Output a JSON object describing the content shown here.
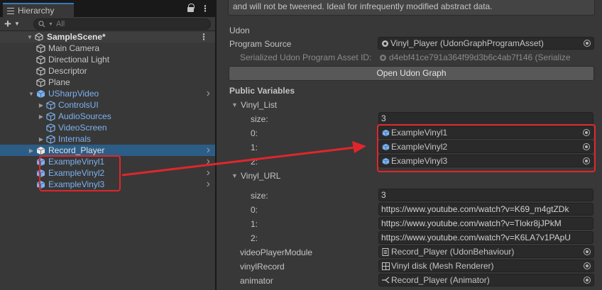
{
  "hierarchy": {
    "tab_label": "Hierarchy",
    "lock_icon": "lock-icon",
    "menu_icon": "kebab-menu-icon",
    "add_label": "+",
    "search_placeholder": "All",
    "scene": {
      "name": "SampleScene*"
    },
    "items": [
      {
        "label": "Main Camera",
        "style": "normal",
        "foldout": false,
        "arrow": false
      },
      {
        "label": "Directional Light",
        "style": "normal",
        "foldout": false,
        "arrow": false
      },
      {
        "label": "Descriptor",
        "style": "normal",
        "foldout": false,
        "arrow": false
      },
      {
        "label": "Plane",
        "style": "normal",
        "foldout": false,
        "arrow": false
      },
      {
        "label": "USharpVideo",
        "style": "prefab",
        "foldout": "open",
        "arrow": true
      },
      {
        "label": "ControlsUI",
        "style": "prefab",
        "foldout": "closed",
        "arrow": false
      },
      {
        "label": "AudioSources",
        "style": "prefab",
        "foldout": "closed",
        "arrow": false
      },
      {
        "label": "VideoScreen",
        "style": "prefab",
        "foldout": false,
        "arrow": false
      },
      {
        "label": "Internals",
        "style": "prefab",
        "foldout": "closed",
        "arrow": false
      },
      {
        "label": "Record_Player",
        "style": "selected",
        "foldout": "closed",
        "arrow": true
      },
      {
        "label": "ExampleVinyl1",
        "style": "prefab",
        "foldout": false,
        "arrow": true
      },
      {
        "label": "ExampleVinyl2",
        "style": "prefab",
        "foldout": false,
        "arrow": true
      },
      {
        "label": "ExampleVinyl3",
        "style": "prefab",
        "foldout": false,
        "arrow": true
      }
    ]
  },
  "inspector": {
    "help_text": "and will not be tweened. Ideal for infrequently modified abstract data.",
    "section_udon": "Udon",
    "program_source_label": "Program Source",
    "program_source_value": "Vinyl_Player (UdonGraphProgramAsset)",
    "serialized_label": "Serialized Udon Program Asset ID:",
    "serialized_value": "d4ebf41ce791a364f99d3b6c4ab7f146 (Serialize",
    "open_graph_button": "Open Udon Graph",
    "public_variables_label": "Public Variables",
    "vinyl_list": {
      "label": "Vinyl_List",
      "size_label": "size:",
      "size_value": "3",
      "items": [
        {
          "index": "0:",
          "value": "ExampleVinyl1"
        },
        {
          "index": "1:",
          "value": "ExampleVinyl2"
        },
        {
          "index": "2:",
          "value": "ExampleVinyl3"
        }
      ]
    },
    "vinyl_url": {
      "label": "Vinyl_URL",
      "size_label": "size:",
      "size_value": "3",
      "items": [
        {
          "index": "0:",
          "value": "https://www.youtube.com/watch?v=K69_m4gtZDk"
        },
        {
          "index": "1:",
          "value": "https://www.youtube.com/watch?v=Tlokr8jJPkM"
        },
        {
          "index": "2:",
          "value": "https://www.youtube.com/watch?v=K6LA7v1PApU"
        }
      ]
    },
    "video_player_module": {
      "label": "videoPlayerModule",
      "value": "Record_Player (UdonBehaviour)"
    },
    "vinyl_record": {
      "label": "vinylRecord",
      "value": "Vinyl disk (Mesh Renderer)"
    },
    "animator": {
      "label": "animator",
      "value": "Record_Player (Animator)"
    }
  },
  "colors": {
    "accent_highlight": "#e0262c",
    "selection": "#2c5d87",
    "prefab_text": "#7cb2f0"
  }
}
